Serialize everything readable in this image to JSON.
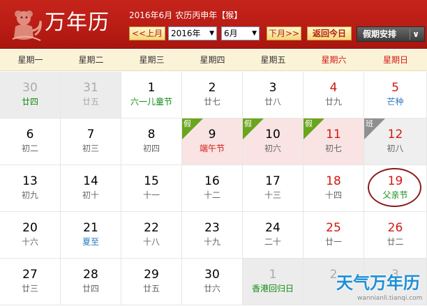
{
  "header": {
    "title": "万年历",
    "info": {
      "solar": "2016年6月",
      "lunar": "农历丙申年",
      "zodiac_bracket_left": "【",
      "zodiac": "猴",
      "zodiac_bracket_right": "】"
    },
    "prev_month_label": "<<上月",
    "year_select": "2016年",
    "month_select": "6月",
    "next_month_label": "下月>>",
    "today_label": "返回今日",
    "holiday_label": "假期安排"
  },
  "weekdays": [
    "星期一",
    "星期二",
    "星期三",
    "星期四",
    "星期五",
    "星期六",
    "星期日"
  ],
  "days": [
    {
      "num": "30",
      "sub": "廿四",
      "type": "other",
      "sub_style": "green"
    },
    {
      "num": "31",
      "sub": "廿五",
      "type": "other"
    },
    {
      "num": "1",
      "sub": "六一儿童节",
      "sub_style": "green"
    },
    {
      "num": "2",
      "sub": "廿七"
    },
    {
      "num": "3",
      "sub": "廿八"
    },
    {
      "num": "4",
      "sub": "廿九",
      "num_style": "red"
    },
    {
      "num": "5",
      "sub": "芒种",
      "num_style": "red",
      "sub_style": "blue"
    },
    {
      "num": "6",
      "sub": "初二"
    },
    {
      "num": "7",
      "sub": "初三"
    },
    {
      "num": "8",
      "sub": "初四"
    },
    {
      "num": "9",
      "sub": "端午节",
      "type": "holiday",
      "tag": "假",
      "sub_style": "red"
    },
    {
      "num": "10",
      "sub": "初六",
      "type": "holiday",
      "tag": "假"
    },
    {
      "num": "11",
      "sub": "初七",
      "type": "holiday",
      "tag": "假",
      "num_style": "red"
    },
    {
      "num": "12",
      "sub": "初八",
      "type": "workday",
      "tag": "班",
      "num_style": "red"
    },
    {
      "num": "13",
      "sub": "初九"
    },
    {
      "num": "14",
      "sub": "初十"
    },
    {
      "num": "15",
      "sub": "十一"
    },
    {
      "num": "16",
      "sub": "十二"
    },
    {
      "num": "17",
      "sub": "十三"
    },
    {
      "num": "18",
      "sub": "十四",
      "num_style": "red"
    },
    {
      "num": "19",
      "sub": "父亲节",
      "num_style": "red",
      "sub_style": "green",
      "today": true
    },
    {
      "num": "20",
      "sub": "十六"
    },
    {
      "num": "21",
      "sub": "夏至",
      "sub_style": "blue"
    },
    {
      "num": "22",
      "sub": "十八"
    },
    {
      "num": "23",
      "sub": "十九"
    },
    {
      "num": "24",
      "sub": "二十"
    },
    {
      "num": "25",
      "sub": "廿一",
      "num_style": "red"
    },
    {
      "num": "26",
      "sub": "廿二",
      "num_style": "red"
    },
    {
      "num": "27",
      "sub": "廿三"
    },
    {
      "num": "28",
      "sub": "廿四"
    },
    {
      "num": "29",
      "sub": "廿五"
    },
    {
      "num": "30",
      "sub": "廿六"
    },
    {
      "num": "1",
      "sub": "香港回归日",
      "type": "other",
      "sub_style": "green"
    },
    {
      "num": "2",
      "sub": "",
      "type": "other"
    },
    {
      "num": "3",
      "sub": "",
      "type": "other"
    }
  ],
  "watermark": {
    "logo": "天气万年历",
    "url": "wannianli.tianqi.com"
  },
  "colors": {
    "header_red": "#b81c14",
    "weekend_red": "#d3180f",
    "holiday_green": "#6aa51e",
    "festival_green": "#128a12",
    "term_blue": "#2a7bc2"
  }
}
